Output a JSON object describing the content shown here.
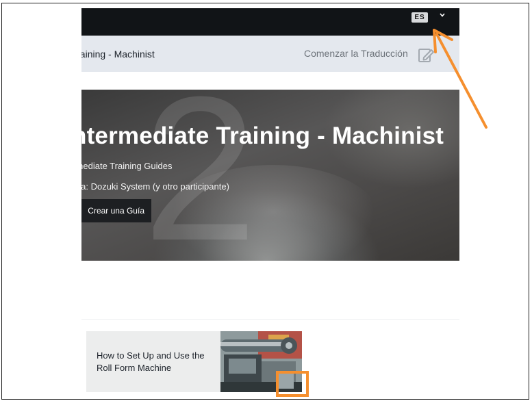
{
  "header": {
    "language_badge": "ES",
    "language_menu_icon": "chevron-down-icon"
  },
  "subheader": {
    "title": "ate Training - Machinist",
    "start_translation_label": "Comenzar la Traducción",
    "edit_icon": "edit-icon"
  },
  "hero": {
    "title": "ntermediate Training - Machinist",
    "category": "ermediate Training Guides",
    "author": "or/a: Dozuki System (y otro participante)",
    "create_guide_label": "Crear una Guía"
  },
  "guide_card": {
    "title": "How to Set Up and Use the Roll Form Machine"
  },
  "annotations": {
    "arrow_color": "#f58f2e",
    "highlight_color": "#f58f2e"
  }
}
